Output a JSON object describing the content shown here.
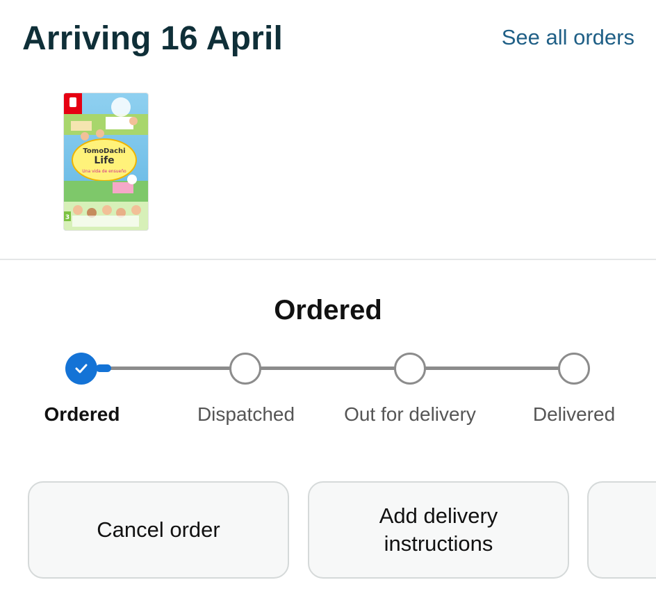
{
  "header": {
    "title": "Arriving 16 April",
    "see_all_label": "See all orders"
  },
  "product": {
    "image_icon": "game-box-cover-image",
    "cover_title_line1": "TomoDachi",
    "cover_title_line2": "Life",
    "cover_subtitle": "Una vida de ensueño",
    "cover_rating": "3"
  },
  "status": {
    "title": "Ordered",
    "current_step": 0
  },
  "steps": [
    {
      "label": "Ordered",
      "state": "done"
    },
    {
      "label": "Dispatched",
      "state": "pending"
    },
    {
      "label": "Out for delivery",
      "state": "pending"
    },
    {
      "label": "Delivered",
      "state": "pending"
    }
  ],
  "actions": [
    {
      "label": "Cancel order"
    },
    {
      "label": "Add delivery instructions"
    },
    {
      "label": ""
    }
  ],
  "colors": {
    "accent": "#1473d6",
    "link": "#1f5f86",
    "track": "#8c8c8c"
  }
}
